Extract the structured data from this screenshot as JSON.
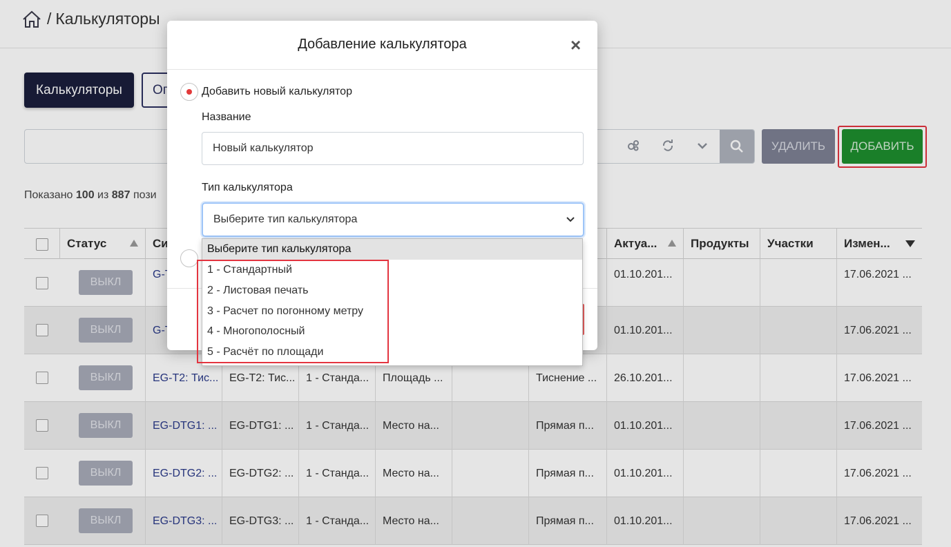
{
  "header": {
    "breadcrumb_sep": "/",
    "title": "Калькуляторы"
  },
  "tabs": [
    {
      "label": "Калькуляторы",
      "active": true
    },
    {
      "label": "Оп",
      "active": false
    }
  ],
  "toolbar": {
    "delete_label": "УДАЛИТЬ",
    "add_label": "ДОБАВИТЬ"
  },
  "summary": {
    "prefix": "Показано",
    "shown": "100",
    "middle": "из",
    "total": "887",
    "suffix": "пози"
  },
  "table": {
    "columns": [
      "Статус",
      "Си",
      "Актуа...",
      "Продукты",
      "Участки",
      "Измен..."
    ],
    "status_label": "ВЫКЛ",
    "rows": [
      {
        "name": "G-T",
        "code": "",
        "type": "",
        "param": "",
        "product": "",
        "actual": "01.10.201...",
        "changed": "17.06.2021 ..."
      },
      {
        "name": "G-T",
        "code": "",
        "type": "",
        "param": "",
        "product": "",
        "actual": "01.10.201...",
        "changed": "17.06.2021 ..."
      },
      {
        "name": "EG-T2: Тис...",
        "code": "EG-T2: Тис...",
        "type": "1 - Станда...",
        "param": "Площадь ...",
        "product": "Тиснение ...",
        "actual": "26.10.201...",
        "changed": "17.06.2021 ..."
      },
      {
        "name": "EG-DTG1: ...",
        "code": "EG-DTG1: ...",
        "type": "1 - Станда...",
        "param": "Место на...",
        "product": "Прямая п...",
        "actual": "01.10.201...",
        "changed": "17.06.2021 ..."
      },
      {
        "name": "EG-DTG2: ...",
        "code": "EG-DTG2: ...",
        "type": "1 - Станда...",
        "param": "Место на...",
        "product": "Прямая п...",
        "actual": "01.10.201...",
        "changed": "17.06.2021 ..."
      },
      {
        "name": "EG-DTG3: ...",
        "code": "EG-DTG3: ...",
        "type": "1 - Станда...",
        "param": "Место на...",
        "product": "Прямая п...",
        "actual": "01.10.201...",
        "changed": "17.06.2021 ..."
      }
    ]
  },
  "modal": {
    "title": "Добавление калькулятора",
    "close": "×",
    "radio_new_label": "Добавить новый калькулятор",
    "name_label": "Название",
    "name_value": "Новый калькулятор",
    "type_label": "Тип калькулятора",
    "type_selected": "Выберите тип калькулятора",
    "type_options": [
      "Выберите тип калькулятора",
      "1 - Стандартный",
      "2 - Листовая печать",
      "3 - Расчет по погонному метру",
      "4 - Многополосный",
      "5 - Расчёт по площади"
    ]
  },
  "colors": {
    "tab_active_bg": "#1a1e3c",
    "add_button": "#1e8e2e",
    "delete_button": "#7d8194",
    "highlight": "#e3343f",
    "link": "#2b3a8a",
    "radio_dot": "#e23a3a"
  }
}
